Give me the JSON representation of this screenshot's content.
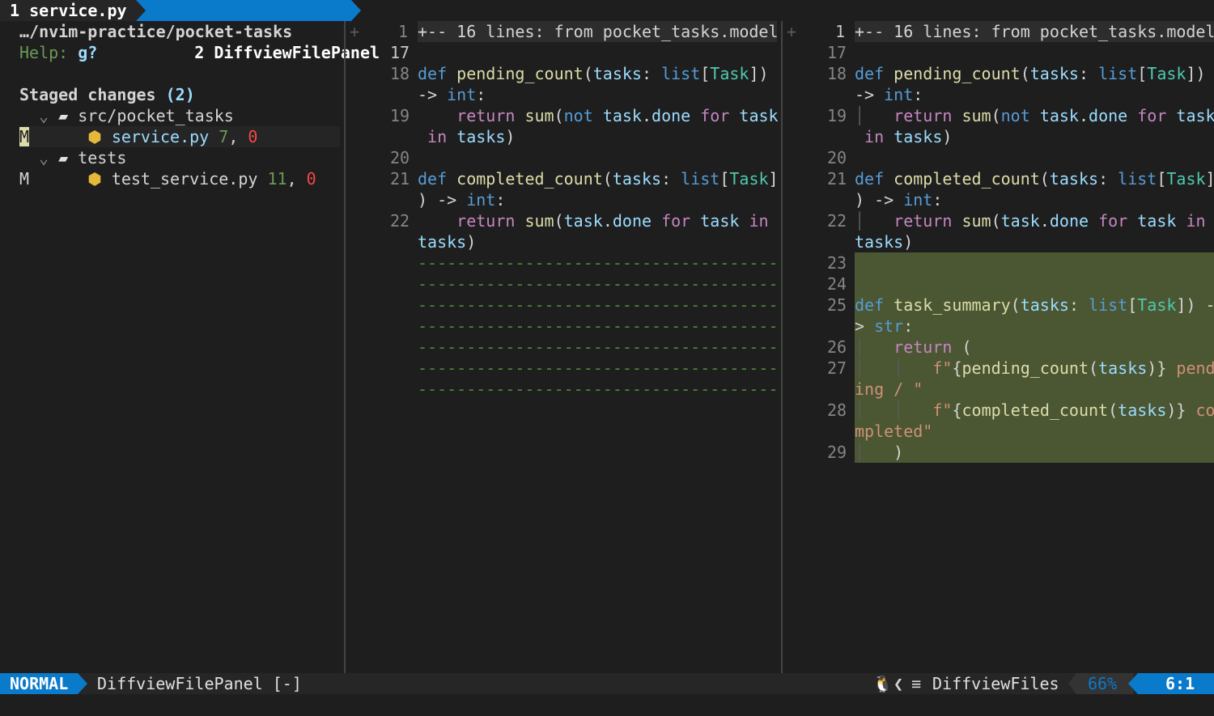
{
  "tabline": {
    "tab1": " 1 service.py ",
    "tab2": "  2 DiffviewFilePanel "
  },
  "panel": {
    "path": "…/nvim-practice/pocket-tasks",
    "help_label": "Help: ",
    "help_key": "g?",
    "staged_title": "Staged changes ",
    "staged_count": "(2)",
    "folder1": "src/pocket_tasks",
    "folder2": "tests",
    "file1": {
      "status": "M",
      "name": "service.py",
      "adds": "7",
      "dels": "0"
    },
    "file2": {
      "status": "M",
      "name": "test_service.py",
      "adds": "11",
      "dels": "0"
    }
  },
  "diff": {
    "fold_text": "+-- 16 lines: from pocket_tasks.model",
    "fold_sign": "+",
    "left_numbers": [
      "1",
      "17",
      "18",
      "19",
      "20",
      "21",
      "22"
    ],
    "right_numbers": [
      "1",
      "17",
      "18",
      "19",
      "20",
      "21",
      "22",
      "23",
      "24",
      "25",
      "26",
      "27",
      "28",
      "29"
    ],
    "filler": "-------------------------------------"
  },
  "statusline": {
    "mode": "NORMAL",
    "buffer": "DiffviewFilePanel [-]",
    "filetype": "DiffviewFiles",
    "percent": "66%",
    "position": "6:1"
  },
  "colors": {
    "accent": "#0a7aca",
    "added_bg": "#4b5632",
    "background": "#1e1e1e"
  }
}
